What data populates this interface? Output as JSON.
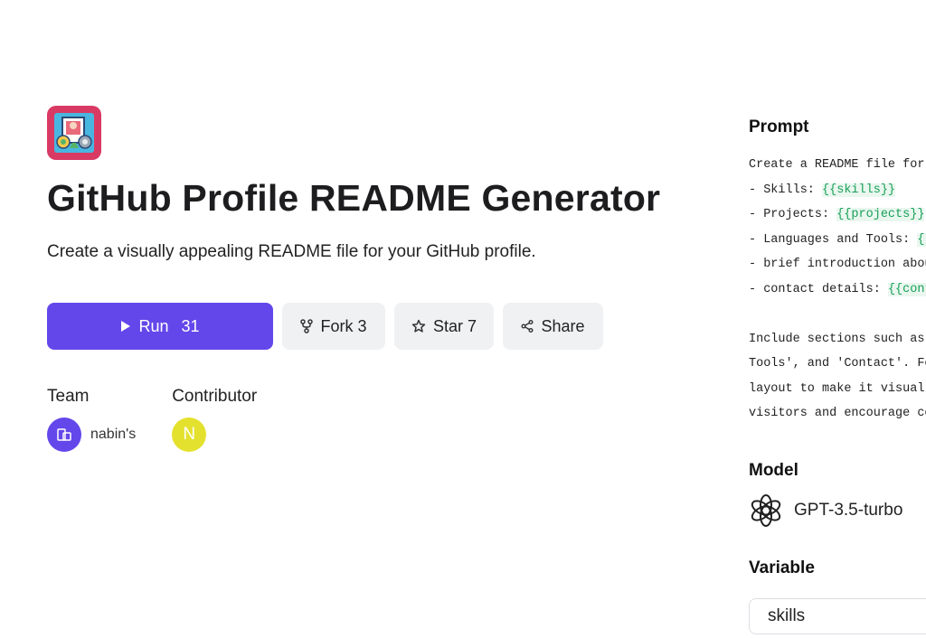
{
  "app": {
    "icon": "profile-picture-icon",
    "title": "GitHub Profile README Generator",
    "description": "Create a visually appealing README file for your GitHub profile.",
    "accent_color": "#6447ea",
    "icon_bg_color": "#d93a63"
  },
  "actions": {
    "run": {
      "label": "Run",
      "count": "31"
    },
    "fork": {
      "label": "Fork 3"
    },
    "star": {
      "label": "Star 7"
    },
    "share": {
      "label": "Share"
    }
  },
  "team": {
    "label": "Team",
    "members": [
      {
        "name": "nabin's",
        "avatar_icon": "team-building-icon"
      }
    ]
  },
  "contributor": {
    "label": "Contributor",
    "members": [
      {
        "initial": "N",
        "avatar_color": "#e4e12e"
      }
    ]
  },
  "prompt": {
    "label": "Prompt",
    "lines": [
      {
        "text": "Create a README file for ",
        "var": ""
      },
      {
        "text": "- Skills: ",
        "var": "{{skills}}"
      },
      {
        "text": "- Projects: ",
        "var": "{{projects}}"
      },
      {
        "text": "- Languages and Tools: ",
        "var": "{{"
      },
      {
        "text": "- brief introduction abou",
        "var": ""
      },
      {
        "text": "- contact details: ",
        "var": "{{cont"
      },
      {
        "text": "",
        "var": ""
      },
      {
        "text": "Include sections such as ",
        "var": ""
      },
      {
        "text": "Tools', and 'Contact'. Fe",
        "var": ""
      },
      {
        "text": "layout to make it visuall",
        "var": ""
      },
      {
        "text": "visitors and encourage co",
        "var": ""
      }
    ]
  },
  "model": {
    "label": "Model",
    "name": "GPT-3.5-turbo",
    "icon": "openai-icon"
  },
  "variable": {
    "label": "Variable",
    "first_field": "skills"
  }
}
